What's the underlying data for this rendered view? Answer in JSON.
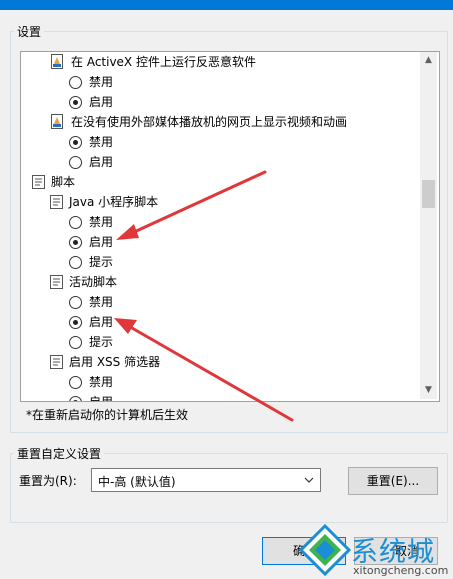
{
  "settings_group": {
    "caption": "设置"
  },
  "tree": {
    "activex_item": {
      "label": "在 ActiveX 控件上运行反恶意软件"
    },
    "activex_options": {
      "disable": "禁用",
      "enable": "启用",
      "selected": "启用"
    },
    "media_item": {
      "label": "在没有使用外部媒体播放机的网页上显示视频和动画"
    },
    "media_options": {
      "disable": "禁用",
      "enable": "启用",
      "selected": "禁用"
    },
    "scripts_category": {
      "label": "脚本"
    },
    "java_item": {
      "label": "Java 小程序脚本"
    },
    "java_options": {
      "disable": "禁用",
      "enable": "启用",
      "prompt": "提示",
      "selected": "启用"
    },
    "active_script_item": {
      "label": "活动脚本"
    },
    "active_script_options": {
      "disable": "禁用",
      "enable": "启用",
      "prompt": "提示",
      "selected": "启用"
    },
    "xss_item": {
      "label": "启用 XSS 筛选器"
    },
    "xss_options": {
      "disable": "禁用",
      "enable": "启用",
      "selected": "启用"
    }
  },
  "restart_note": "*在重新启动你的计算机后生效",
  "reset_group": {
    "caption": "重置自定义设置",
    "reset_to_label": "重置为(R):",
    "reset_level_value": "中-高 (默认值)",
    "reset_button": "重置(E)..."
  },
  "footer": {
    "ok_button_partial": "确",
    "cancel_button_partial": "取消"
  },
  "watermark": {
    "text": "系统城",
    "url": "xitongcheng.com"
  },
  "colors": {
    "title_bar": "#0078d7",
    "annotation_arrow": "#e0373a",
    "watermark_blue": "#1a8fd4",
    "watermark_green": "#3fb34f"
  }
}
